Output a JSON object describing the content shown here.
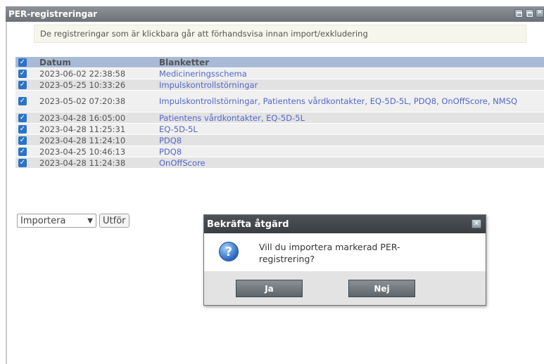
{
  "window": {
    "title": "PER-registreringar",
    "icons": [
      "minimize-icon",
      "restore-icon",
      "close-icon"
    ]
  },
  "info_text": "De registreringar som är klickbara går att förhandsvisa innan import/exkludering",
  "table": {
    "headers": {
      "datum": "Datum",
      "blanketter": "Blanketter"
    },
    "rows": [
      {
        "date": "2023-06-02 22:38:58",
        "forms": "Medicineringsschema",
        "checked": true
      },
      {
        "date": "2023-05-25 10:33:26",
        "forms": "Impulskontrollstörningar",
        "checked": true
      },
      {
        "date": "2023-05-02 07:20:38",
        "forms": "Impulskontrollstörningar, Patientens vårdkontakter, EQ-5D-5L, PDQ8, OnOffScore, NMSQ",
        "checked": true
      },
      {
        "date": "2023-04-28 16:05:00",
        "forms": "Patientens vårdkontakter, EQ-5D-5L",
        "checked": true
      },
      {
        "date": "2023-04-28 11:25:31",
        "forms": "EQ-5D-5L",
        "checked": true
      },
      {
        "date": "2023-04-28 11:24:10",
        "forms": "PDQ8",
        "checked": true
      },
      {
        "date": "2023-04-25 10:46:13",
        "forms": "PDQ8",
        "checked": true
      },
      {
        "date": "2023-04-28 11:24:38",
        "forms": "OnOffScore",
        "checked": true
      }
    ]
  },
  "actions": {
    "select_value": "Importera",
    "execute_label": "Utför"
  },
  "dialog": {
    "title": "Bekräfta åtgärd",
    "message": "Vill du importera markerad PER-registrering?",
    "yes_label": "Ja",
    "no_label": "Nej"
  },
  "colors": {
    "title_bar": "#7d8288",
    "header_row": "#a8bad6",
    "link": "#5566cc",
    "checkbox": "#2b74c7",
    "dialog_title": "#43474c"
  }
}
